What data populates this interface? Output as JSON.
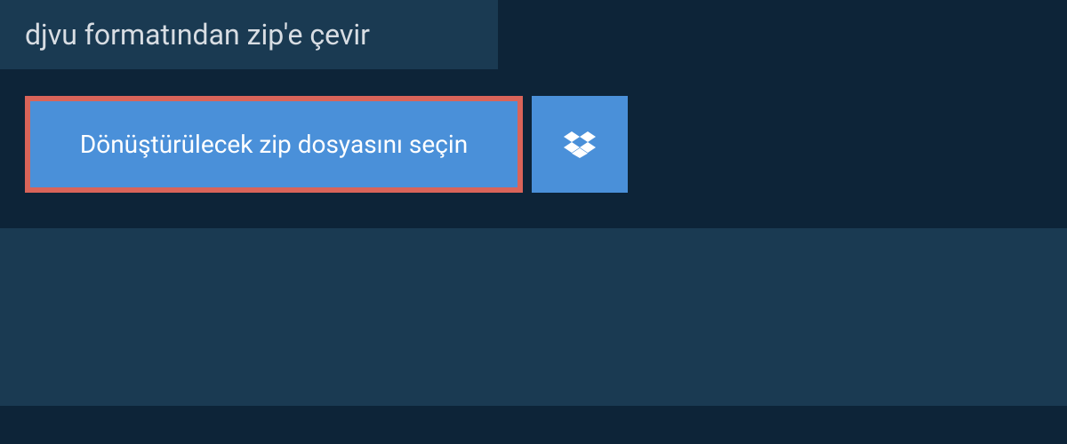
{
  "header": {
    "title": "djvu formatından zip'e çevir"
  },
  "actions": {
    "select_file_label": "Dönüştürülecek zip dosyasını seçin",
    "dropbox_icon_name": "dropbox-icon"
  },
  "colors": {
    "background_dark": "#0d2438",
    "panel_dark": "#1a3a52",
    "button_blue": "#4a90d9",
    "highlight_border": "#d96459",
    "text_light": "#d8dde3",
    "text_white": "#ffffff"
  }
}
